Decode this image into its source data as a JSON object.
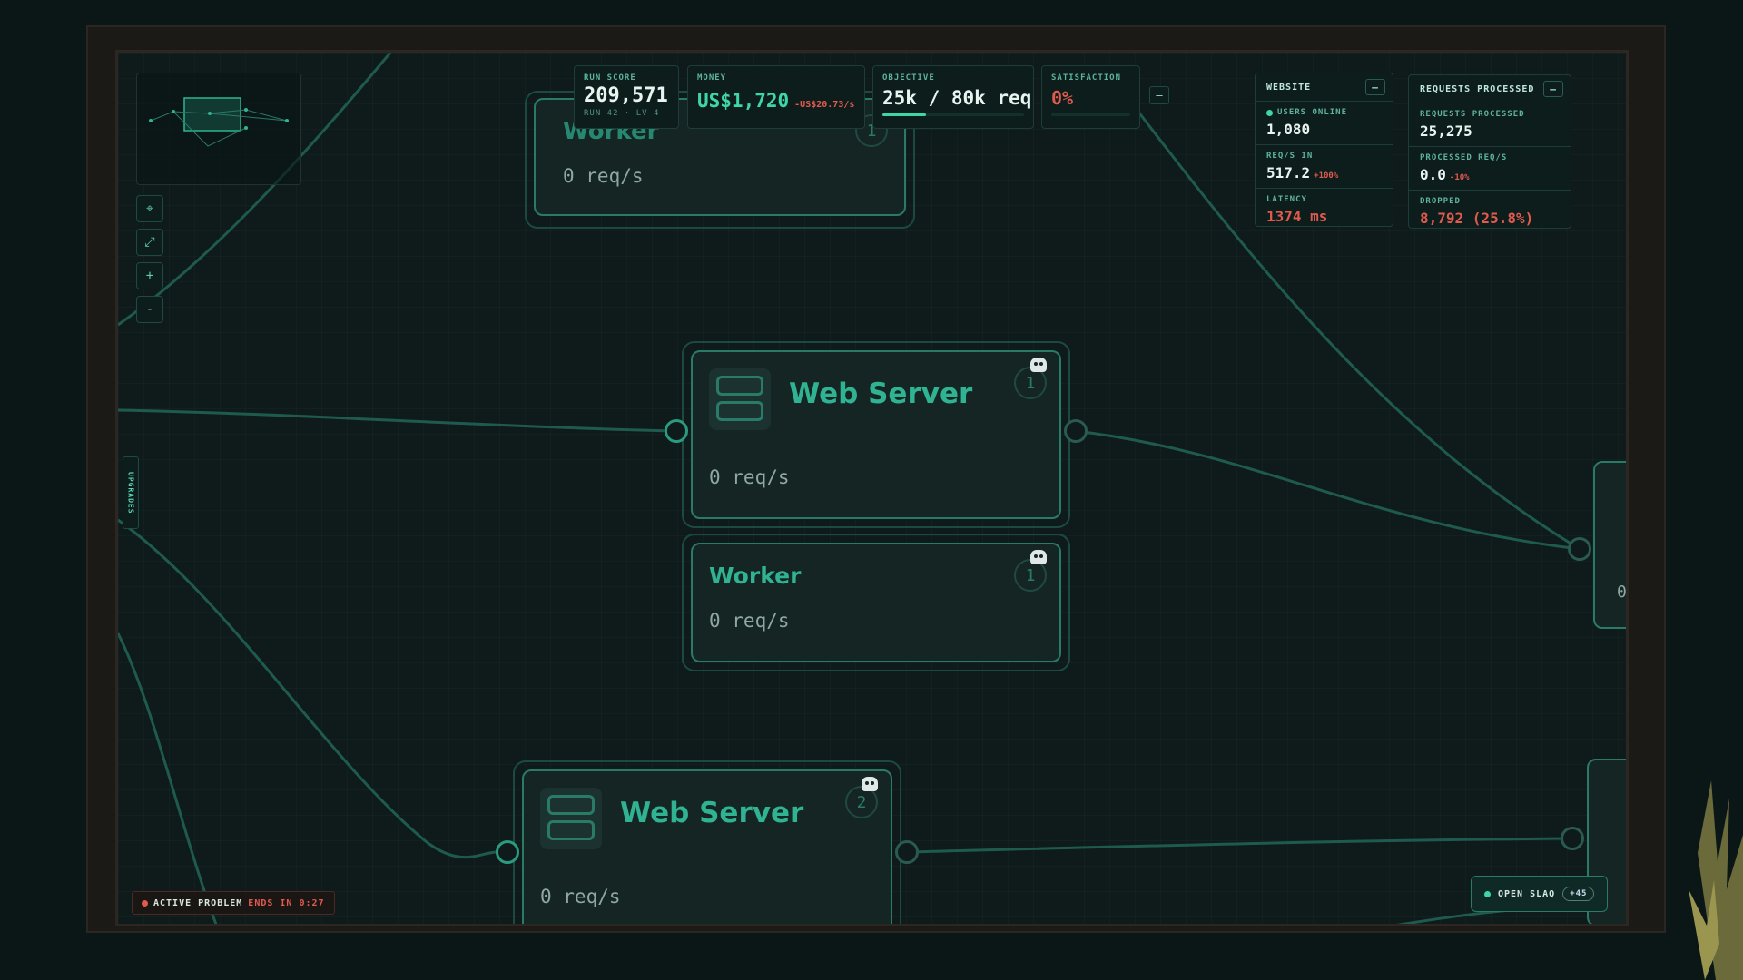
{
  "hud": {
    "run_score": {
      "label": "RUN SCORE",
      "value": "209,571",
      "sub": "RUN 42 · LV 4"
    },
    "money": {
      "label": "MONEY",
      "value": "US$1,720",
      "rate": "-US$20.73/s"
    },
    "objective": {
      "label": "OBJECTIVE",
      "value": "25k / 80k req",
      "progress": 0.31
    },
    "satisfaction": {
      "label": "SATISFACTION",
      "value": "0%",
      "progress": 0.0
    },
    "collapse_label": "–"
  },
  "toolbar": {
    "locate_icon": "⌖",
    "fit_icon": "⤢",
    "zoom_in_label": "+",
    "zoom_out_label": "-",
    "upgrades_label": "UPGRADES"
  },
  "website_panel": {
    "title": "WEBSITE",
    "collapse_label": "–",
    "users_online": {
      "label": "USERS ONLINE",
      "value": "1,080"
    },
    "req_in": {
      "label": "REQ/S IN",
      "value": "517.2",
      "delta": "+100%"
    },
    "latency": {
      "label": "LATENCY",
      "value": "1374 ms"
    }
  },
  "requests_panel": {
    "title": "REQUESTS PROCESSED",
    "collapse_label": "–",
    "processed": {
      "label": "REQUESTS PROCESSED",
      "value": "25,275"
    },
    "processed_rate": {
      "label": "PROCESSED REQ/S",
      "value": "0.0",
      "delta": "-10%"
    },
    "dropped": {
      "label": "DROPPED",
      "value": "8,792 (25.8%)"
    }
  },
  "nodes": [
    {
      "title": "Worker",
      "rate": "0 req/s",
      "level": "1"
    },
    {
      "title": "Web Server",
      "rate": "0 req/s",
      "level": "1"
    },
    {
      "title": "Worker",
      "rate": "0 req/s",
      "level": "1"
    },
    {
      "title": "Web Server",
      "rate": "0 req/s",
      "level": "2"
    }
  ],
  "partial_node_text": "0",
  "status": {
    "active_problem_label": "ACTIVE PROBLEM",
    "ends_label": "ENDS IN 0:27",
    "slaq_label": "OPEN SLAQ",
    "slaq_badge": "+45"
  },
  "colors": {
    "accent": "#3fd6a6",
    "danger": "#e05a4e",
    "node_border": "#2a7a68"
  }
}
